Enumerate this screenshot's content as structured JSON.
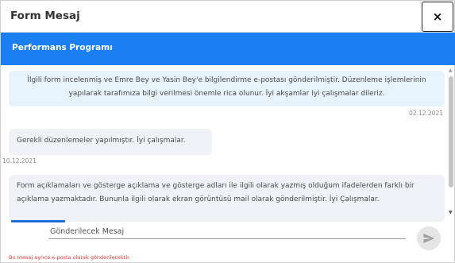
{
  "header": {
    "title": "Form Mesaj",
    "close_glyph": "×"
  },
  "banner": {
    "title": "Performans Programı"
  },
  "messages": [
    {
      "text": "İlgili form incelenmiş ve Emre Bey ve Yasin Bey'e bilgilendirme e-postası gönderilmiştir. Düzenleme işlemlerinin yapılarak tarafımıza bilgi verilmesi önemle rica olunur. İyi akşamlar iyi çalışmalar dileriz.",
      "date": "02.12.2021"
    },
    {
      "text": "Gerekli düzenlemeler yapılmıştır. İyi çalışmalar.",
      "date": "10.12.2021"
    },
    {
      "text": "Form açıklamaları ve gösterge açıklama ve gösterge adları ile ilgili olarak yazmış olduğum ifadelerden farklı bir açıklama yazmaktadır. Bununla ilgili olarak ekran görüntüsü mail olarak gönderilmiştir. İyi Çalışmalar."
    }
  ],
  "compose": {
    "placeholder": "Gönderilecek Mesaj",
    "send_icon": "send-icon"
  },
  "note": "Bu mesaj ayrıca e-posta olarak gönderilecektir.",
  "colors": {
    "accent": "#1b7ff4",
    "bubble_highlight": "#e6f2fc",
    "bubble": "#f0f2f7",
    "note": "#e53935"
  }
}
